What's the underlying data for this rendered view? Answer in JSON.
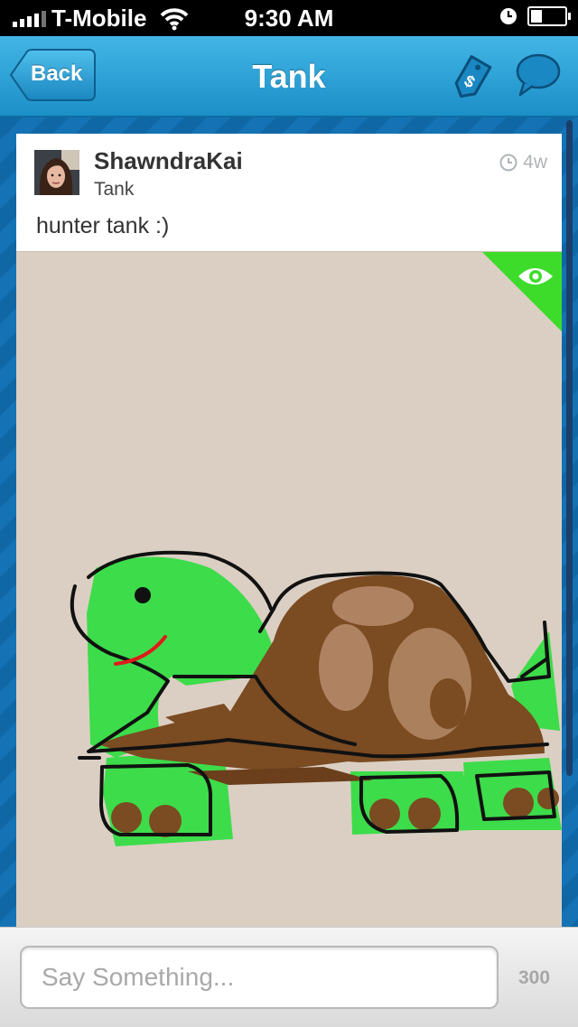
{
  "status_bar": {
    "carrier": "T-Mobile",
    "time": "9:30 AM"
  },
  "navbar": {
    "back_label": "Back",
    "title": "Tank"
  },
  "post": {
    "username": "ShawndraKai",
    "subtitle": "Tank",
    "time_ago": "4w",
    "caption": "hunter tank :)"
  },
  "comment": {
    "placeholder": "Say Something...",
    "char_count": "300"
  },
  "icons": [
    "signal-icon",
    "wifi-icon",
    "alarm-icon",
    "battery-icon",
    "tag-dollar-icon",
    "chat-bubble-icon",
    "clock-icon",
    "eye-icon"
  ],
  "colors": {
    "accent_blue": "#1b8fc7",
    "eye_badge_green": "#3ddc2b",
    "drawing_bg": "#dbcfc3"
  }
}
